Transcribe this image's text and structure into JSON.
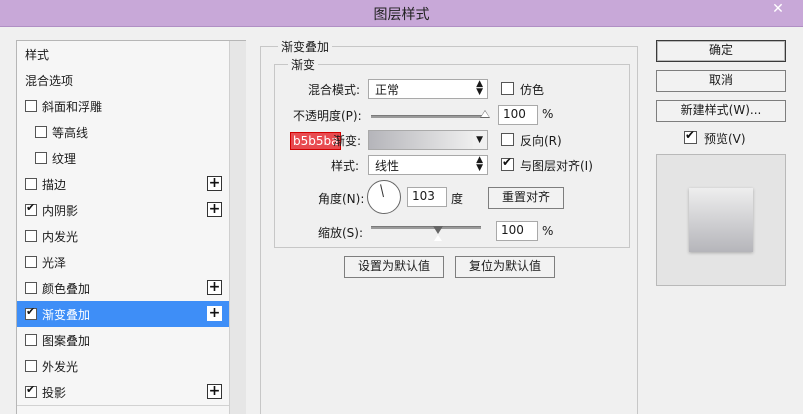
{
  "window": {
    "title": "图层样式",
    "close_glyph": "✕"
  },
  "sidebar": {
    "items": [
      {
        "label": "样式",
        "has_checkbox": false,
        "checked": false,
        "has_plus": false,
        "indent": false,
        "selected": false
      },
      {
        "label": "混合选项",
        "has_checkbox": false,
        "checked": false,
        "has_plus": false,
        "indent": false,
        "selected": false
      },
      {
        "label": "斜面和浮雕",
        "has_checkbox": true,
        "checked": false,
        "has_plus": false,
        "indent": false,
        "selected": false
      },
      {
        "label": "等高线",
        "has_checkbox": true,
        "checked": false,
        "has_plus": false,
        "indent": true,
        "selected": false
      },
      {
        "label": "纹理",
        "has_checkbox": true,
        "checked": false,
        "has_plus": false,
        "indent": true,
        "selected": false
      },
      {
        "label": "描边",
        "has_checkbox": true,
        "checked": false,
        "has_plus": true,
        "indent": false,
        "selected": false
      },
      {
        "label": "内阴影",
        "has_checkbox": true,
        "checked": true,
        "has_plus": true,
        "indent": false,
        "selected": false
      },
      {
        "label": "内发光",
        "has_checkbox": true,
        "checked": false,
        "has_plus": false,
        "indent": false,
        "selected": false
      },
      {
        "label": "光泽",
        "has_checkbox": true,
        "checked": false,
        "has_plus": false,
        "indent": false,
        "selected": false
      },
      {
        "label": "颜色叠加",
        "has_checkbox": true,
        "checked": false,
        "has_plus": true,
        "indent": false,
        "selected": false
      },
      {
        "label": "渐变叠加",
        "has_checkbox": true,
        "checked": true,
        "has_plus": true,
        "indent": false,
        "selected": true
      },
      {
        "label": "图案叠加",
        "has_checkbox": true,
        "checked": false,
        "has_plus": false,
        "indent": false,
        "selected": false
      },
      {
        "label": "外发光",
        "has_checkbox": true,
        "checked": false,
        "has_plus": false,
        "indent": false,
        "selected": false
      },
      {
        "label": "投影",
        "has_checkbox": true,
        "checked": true,
        "has_plus": true,
        "indent": false,
        "selected": false
      }
    ],
    "plus_glyph": "+"
  },
  "panel": {
    "section_title": "渐变叠加",
    "group_title": "渐变",
    "blend_mode": {
      "label": "混合模式:",
      "value": "正常"
    },
    "dither": {
      "label": "仿色",
      "checked": false
    },
    "opacity": {
      "label": "不透明度(P):",
      "value": "100",
      "unit": "%",
      "level": 1.0
    },
    "gradient": {
      "hex_label": "b5b5ba",
      "label": "渐变:",
      "start_color": "#b5b5ba",
      "end_color": "#eeeeee"
    },
    "reverse": {
      "label": "反向(R)",
      "checked": false
    },
    "style": {
      "label": "样式:",
      "value": "线性"
    },
    "align": {
      "label": "与图层对齐(I)",
      "checked": true
    },
    "angle": {
      "label": "角度(N):",
      "value": "103",
      "unit": "度"
    },
    "reset_align_button": "重置对齐",
    "scale": {
      "label": "缩放(S):",
      "value": "100",
      "unit": "%",
      "level": 0.5
    },
    "set_default_button": "设置为默认值",
    "reset_default_button": "复位为默认值"
  },
  "right": {
    "ok_button": "确定",
    "cancel_button": "取消",
    "new_style_button": "新建样式(W)...",
    "preview": {
      "label": "预览(V)",
      "checked": true
    }
  },
  "colors": {
    "accent_selected": "#3e8ef7",
    "title_bar": "#c8a8d8",
    "hex_label_bg": "#e84b50"
  }
}
